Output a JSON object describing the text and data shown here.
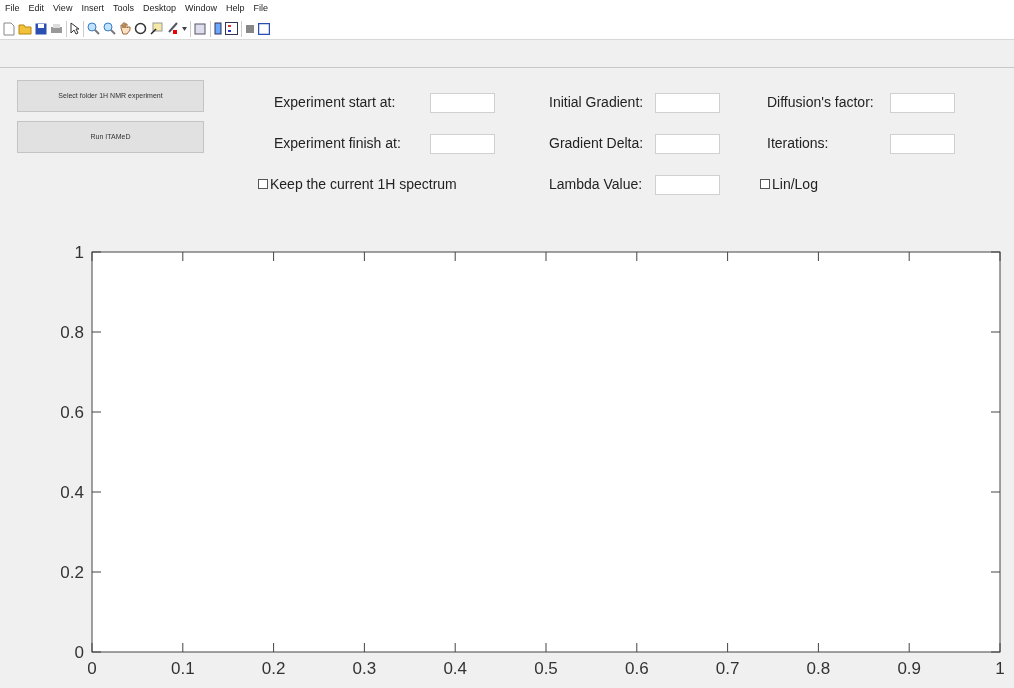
{
  "menu": [
    "File",
    "Edit",
    "View",
    "Insert",
    "Tools",
    "Desktop",
    "Window",
    "Help",
    "File"
  ],
  "buttons": [
    "Select folder 1H NMR experiment",
    "Run ITAMeD"
  ],
  "fields": [
    {
      "kind": "input",
      "label": "Experiment start at:"
    },
    {
      "kind": "input",
      "label": "Initial Gradient:"
    },
    {
      "kind": "input",
      "label": "Diffusion's factor:"
    },
    {
      "kind": "input",
      "label": "Experiment finish at:"
    },
    {
      "kind": "input",
      "label": "Gradient Delta:"
    },
    {
      "kind": "input",
      "label": "Iterations:"
    },
    {
      "kind": "checkbox",
      "label": "Keep the current 1H spectrum",
      "checked": false
    },
    {
      "kind": "input",
      "label": "Lambda Value:"
    },
    {
      "kind": "checkbox",
      "label": "Lin/Log",
      "checked": false
    }
  ],
  "axes": {
    "chart_data": {
      "type": "line",
      "xlim": [
        0,
        1
      ],
      "ylim": [
        0,
        1
      ],
      "xticks": [
        {
          "value": 0,
          "label": "0"
        },
        {
          "value": 0.1,
          "label": "0.1"
        },
        {
          "value": 0.2,
          "label": "0.2"
        },
        {
          "value": 0.3,
          "label": "0.3"
        },
        {
          "value": 0.4,
          "label": "0.4"
        },
        {
          "value": 0.5,
          "label": "0.5"
        },
        {
          "value": 0.6,
          "label": "0.6"
        },
        {
          "value": 0.7,
          "label": "0.7"
        },
        {
          "value": 0.8,
          "label": "0.8"
        },
        {
          "value": 0.9,
          "label": "0.9"
        },
        {
          "value": 1,
          "label": "1"
        }
      ],
      "yticks": [
        {
          "value": 0,
          "label": "0"
        },
        {
          "value": 0.2,
          "label": "0.2"
        },
        {
          "value": 0.4,
          "label": "0.4"
        },
        {
          "value": 0.6,
          "label": "0.6"
        },
        {
          "value": 0.8,
          "label": "0.8"
        },
        {
          "value": 1,
          "label": "1"
        }
      ]
    }
  }
}
